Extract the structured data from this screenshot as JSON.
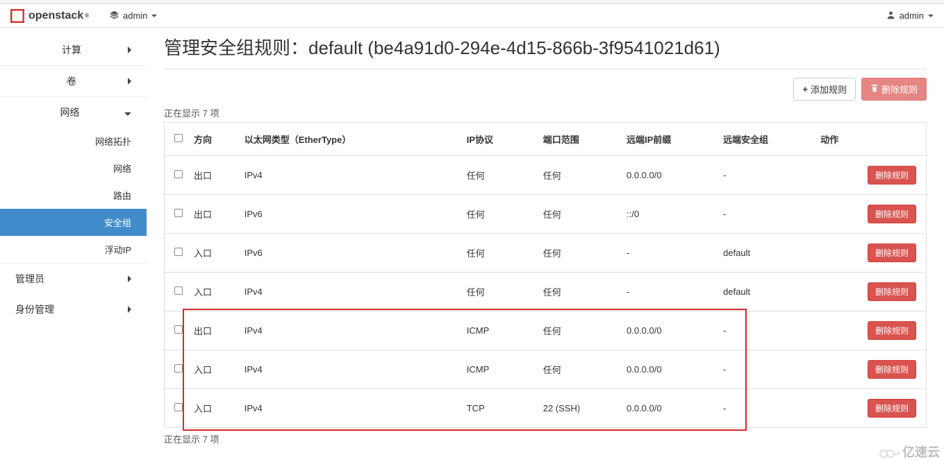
{
  "brand": {
    "name": "openstack",
    "reg": "®"
  },
  "project_switcher": {
    "icon": "layers-icon",
    "label": "admin"
  },
  "user_menu": {
    "icon": "user-icon",
    "label": "admin"
  },
  "sidebar": {
    "items": [
      {
        "label": "计算",
        "kind": "panel",
        "expanded": false
      },
      {
        "label": "卷",
        "kind": "panel",
        "expanded": false
      },
      {
        "label": "网络",
        "kind": "panel",
        "expanded": true,
        "children": [
          {
            "label": "网络拓扑",
            "active": false
          },
          {
            "label": "网络",
            "active": false
          },
          {
            "label": "路由",
            "active": false
          },
          {
            "label": "安全组",
            "active": true
          },
          {
            "label": "浮动IP",
            "active": false
          }
        ]
      },
      {
        "label": "管理员",
        "kind": "panel",
        "expanded": false
      },
      {
        "label": "身份管理",
        "kind": "panel",
        "expanded": false
      }
    ]
  },
  "page": {
    "title": "管理安全组规则：default (be4a91d0-294e-4d15-866b-3f9541021d61)"
  },
  "toolbar": {
    "add_rule": "添加规则",
    "delete_rules": "删除规则"
  },
  "table": {
    "count_top": "正在显示 7 项",
    "count_bottom": "正在显示 7 项",
    "columns": {
      "direction": "方向",
      "ethertype": "以太网类型（EtherType）",
      "ip_protocol": "IP协议",
      "port_range": "端口范围",
      "remote_prefix": "远端IP前缀",
      "remote_group": "远端安全组",
      "actions": "动作"
    },
    "row_action": "删除规则",
    "rows": [
      {
        "direction": "出口",
        "ethertype": "IPv4",
        "ip_protocol": "任何",
        "port_range": "任何",
        "remote_prefix": "0.0.0.0/0",
        "remote_group": "-"
      },
      {
        "direction": "出口",
        "ethertype": "IPv6",
        "ip_protocol": "任何",
        "port_range": "任何",
        "remote_prefix": "::/0",
        "remote_group": "-"
      },
      {
        "direction": "入口",
        "ethertype": "IPv6",
        "ip_protocol": "任何",
        "port_range": "任何",
        "remote_prefix": "-",
        "remote_group": "default"
      },
      {
        "direction": "入口",
        "ethertype": "IPv4",
        "ip_protocol": "任何",
        "port_range": "任何",
        "remote_prefix": "-",
        "remote_group": "default"
      },
      {
        "direction": "出口",
        "ethertype": "IPv4",
        "ip_protocol": "ICMP",
        "port_range": "任何",
        "remote_prefix": "0.0.0.0/0",
        "remote_group": "-"
      },
      {
        "direction": "入口",
        "ethertype": "IPv4",
        "ip_protocol": "ICMP",
        "port_range": "任何",
        "remote_prefix": "0.0.0.0/0",
        "remote_group": "-"
      },
      {
        "direction": "入口",
        "ethertype": "IPv4",
        "ip_protocol": "TCP",
        "port_range": "22 (SSH)",
        "remote_prefix": "0.0.0.0/0",
        "remote_group": "-"
      }
    ]
  },
  "watermark": "亿速云"
}
